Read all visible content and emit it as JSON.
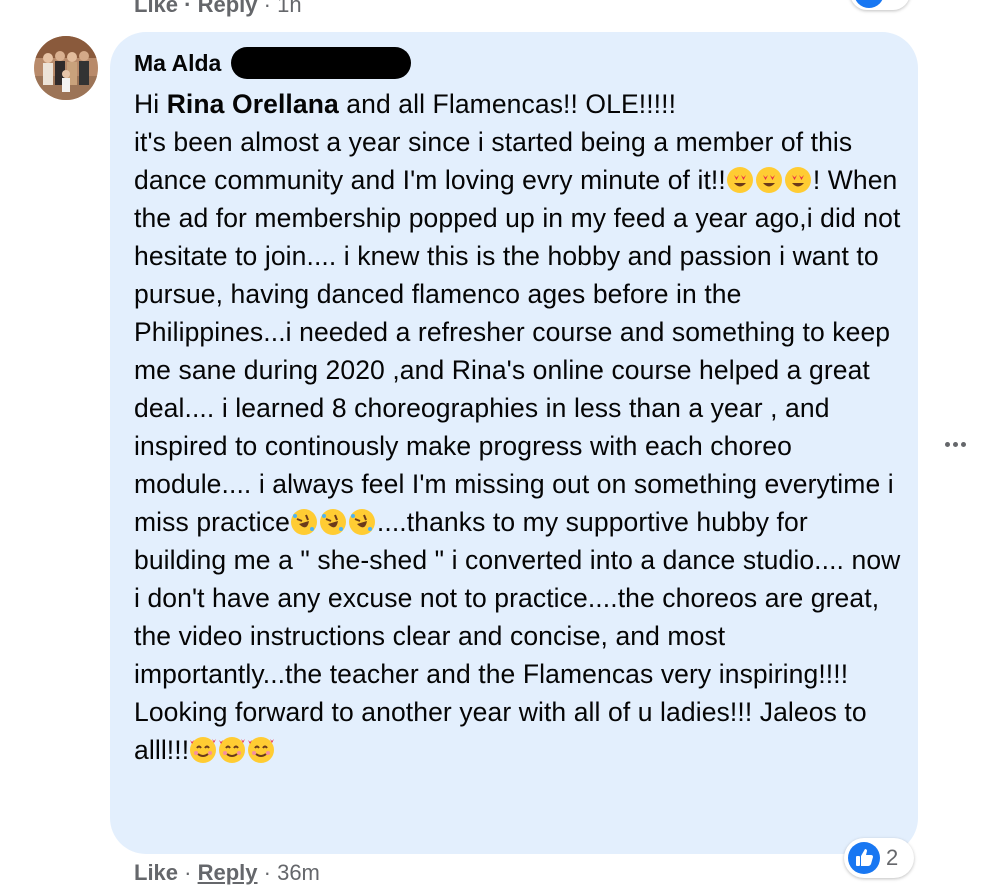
{
  "top_actions": {
    "like": "Like",
    "sep1": " · ",
    "reply": "Reply",
    "sep2": " · ",
    "time": "1h"
  },
  "comment": {
    "author": "Ma Alda",
    "greeting_prefix": "Hi ",
    "mention": "Rina Orellana",
    "text_1": " and all Flamencas!! OLE!!!!!\nit's been almost a year since i started being a member of this dance community and I'm loving evry minute of it!!",
    "text_2": "! When the ad for membership popped up in my feed a year ago,i did not hesitate to join.... i knew this is the hobby and passion i want to pursue, having danced flamenco ages before in the Philippines...i needed a refresher course and something to keep me sane during 2020 ,and Rina's online course helped a great deal.... i learned 8 choreographies in less than a year , and inspired to continously make progress with each choreo module.... i always feel I'm missing out on something everytime i miss practice",
    "text_3": "....thanks to my supportive hubby for building me a \" she-shed \" i converted into a dance studio.... now i don't have any excuse not to practice....the choreos are great, the video instructions clear and concise, and most importantly...the teacher and the Flamencas very inspiring!!!! Looking forward to another year with all of u ladies!!! Jaleos to alll!!!",
    "emoji_group_1": "heart-eyes-emoji",
    "emoji_group_2": "rolling-laughing-emoji",
    "emoji_group_3": "smiling-hearts-emoji"
  },
  "reactions": {
    "count": "2",
    "type": "like-icon",
    "color": "#1877f2"
  },
  "bottom_actions": {
    "like": "Like",
    "sep1": " · ",
    "reply": "Reply",
    "sep2": " · ",
    "time": "36m"
  },
  "colors": {
    "bubble": "#e3effd",
    "meta": "#65676b",
    "text": "#050505",
    "accent": "#1877f2"
  }
}
